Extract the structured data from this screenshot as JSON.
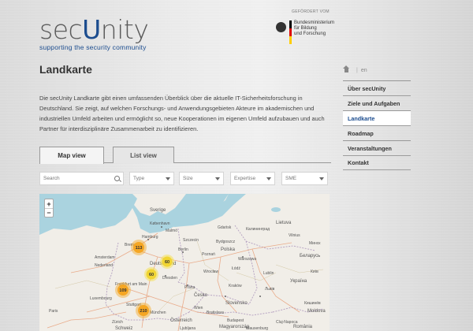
{
  "header": {
    "logo_prefix": "sec",
    "logo_u": "U",
    "logo_suffix": "nity",
    "tagline": "supporting the security community",
    "sponsor_label": "GEFÖRDERT VOM",
    "ministry_line1": "Bundesministerium",
    "ministry_line2": "für Bildung",
    "ministry_line3": "und Forschung",
    "flag_colors": [
      "#000000",
      "#dd0000",
      "#ffce00"
    ]
  },
  "page": {
    "title": "Landkarte",
    "intro": "Die secUnity Landkarte gibt einen umfassenden Überblick über die aktuelle IT-Sicherheitsforschung in Deutschland. Sie zeigt, auf welchen Forschungs- und Anwendungsgebieten Akteure im akademischen und industriellen Umfeld arbeiten und ermöglicht so, neue Kooperationen im eigenen Umfeld aufzubauen und auch Partner für interdisziplinäre Zusammenarbeit zu identifizieren."
  },
  "tabs": [
    {
      "label": "Map view",
      "active": true
    },
    {
      "label": "List view",
      "active": false
    }
  ],
  "filters": {
    "search_placeholder": "Search",
    "type": "Type",
    "size": "Size",
    "expertise": "Expertise",
    "sme": "SME"
  },
  "map": {
    "zoom_in": "+",
    "zoom_out": "−",
    "cluster_color": "#f5a623",
    "clusters": [
      "113",
      "60",
      "60",
      "109",
      "210"
    ],
    "labels": {
      "kopenhagen": "København",
      "sweden": "Sverige",
      "malmo": "Malmö",
      "gdansk": "Gdańsk",
      "kaliningrad": "Калининград",
      "lietuva": "Lietuva",
      "vilnius": "Vilnius",
      "minsk": "Минск",
      "hamburg": "Hamburg",
      "szczecin": "Szczecin",
      "bydgoszcz": "Bydgoszcz",
      "bremen": "Bremen",
      "berlin": "Berlin",
      "polska": "Polska",
      "poznan": "Poznań",
      "warszawa": "Warszawa",
      "belarus": "Беларусь",
      "amsterdam": "Amsterdam",
      "nederland": "Nederland",
      "deutschland": "Deutschland",
      "wroclaw": "Wrocław",
      "lodz": "Łódź",
      "lublin": "Lublin",
      "dresden": "Dresden",
      "praha": "Praha",
      "krakow": "Kraków",
      "cesko": "Česko",
      "frankfurt": "Frankfurt am Main",
      "luxembourg": "Luxembourg",
      "stuttgart": "Stuttgart",
      "munchen": "München",
      "wien": "Wien",
      "bratislava": "Bratislava",
      "slovensko": "Slovensko",
      "paris": "Paris",
      "osterreich": "Österreich",
      "budapest": "Budapest",
      "magyarorszag": "Magyarország",
      "ukraine": "Україна",
      "lviv": "Львів",
      "kyiv": "Київ",
      "zurich": "Zürich",
      "schweiz": "Schweiz",
      "ljubljana": "Ljubljana",
      "cluj": "Cluj-Napoca",
      "kishinev": "Кишинёв",
      "moldova": "Moldova",
      "romania": "România",
      "klausenburg": "Klausenburg"
    }
  },
  "sidebar": {
    "lang_sep": "|",
    "lang_en": "en",
    "items": [
      {
        "label": "Über secUnity",
        "active": false
      },
      {
        "label": "Ziele und Aufgaben",
        "active": false
      },
      {
        "label": "Landkarte",
        "active": true
      },
      {
        "label": "Roadmap",
        "active": false
      },
      {
        "label": "Veranstaltungen",
        "active": false
      },
      {
        "label": "Kontakt",
        "active": false
      }
    ]
  }
}
